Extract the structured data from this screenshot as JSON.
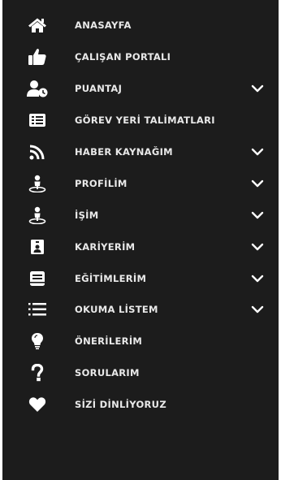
{
  "menu": {
    "items": [
      {
        "label": "ANASAYFA",
        "icon": "home-icon",
        "has_submenu": false
      },
      {
        "label": "ÇALIŞAN PORTALI",
        "icon": "thumbs-up-icon",
        "has_submenu": false
      },
      {
        "label": "PUANTAJ",
        "icon": "user-clock-icon",
        "has_submenu": true
      },
      {
        "label": "GÖREV YERİ TALİMATLARI",
        "icon": "list-card-icon",
        "has_submenu": false
      },
      {
        "label": "HABER KAYNAĞIM",
        "icon": "rss-icon",
        "has_submenu": true
      },
      {
        "label": "PROFİLİM",
        "icon": "person-pin-icon",
        "has_submenu": true
      },
      {
        "label": "İŞİM",
        "icon": "person-pin-icon",
        "has_submenu": true
      },
      {
        "label": "KARİYERİM",
        "icon": "id-badge-icon",
        "has_submenu": true
      },
      {
        "label": "EĞİTİMLERİM",
        "icon": "book-icon",
        "has_submenu": true
      },
      {
        "label": "OKUMA LİSTEM",
        "icon": "list-icon",
        "has_submenu": true
      },
      {
        "label": "ÖNERİLERİM",
        "icon": "lightbulb-icon",
        "has_submenu": false
      },
      {
        "label": "SORULARIM",
        "icon": "question-icon",
        "has_submenu": false
      },
      {
        "label": "SİZİ DİNLİYORUZ",
        "icon": "heart-icon",
        "has_submenu": false
      }
    ]
  },
  "colors": {
    "background": "#1c1c1c",
    "text": "#e9e9e9",
    "icon": "#ffffff"
  }
}
